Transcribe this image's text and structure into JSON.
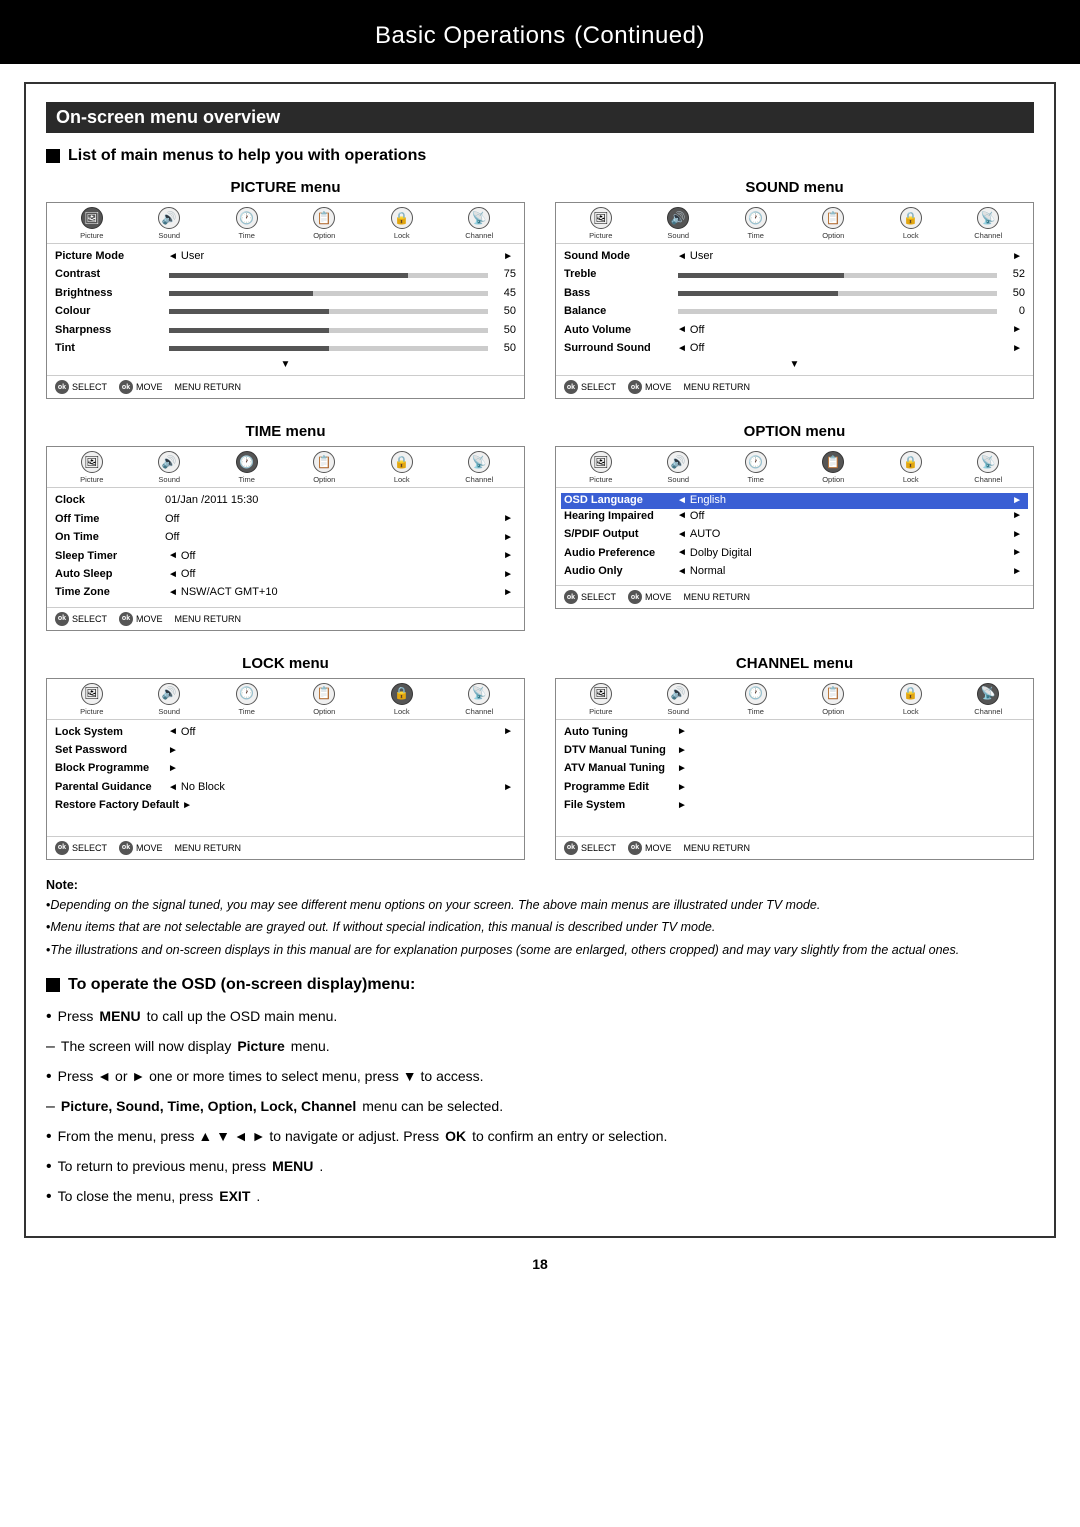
{
  "page": {
    "title": "Basic Operations",
    "title_continued": "Continued",
    "page_number": "18"
  },
  "section": {
    "header": "On-screen menu overview",
    "list_title": "List of main menus to help you with operations"
  },
  "icons": {
    "picture": "🖼",
    "sound": "🔊",
    "time": "🕐",
    "option": "📋",
    "lock": "🔒",
    "channel": "📡"
  },
  "picture_menu": {
    "title": "PICTURE menu",
    "active_icon": "Picture",
    "icons": [
      "Picture",
      "Sound",
      "Time",
      "Option",
      "Lock",
      "Channel"
    ],
    "rows": [
      {
        "label": "Picture Mode",
        "arrow_left": "◄",
        "value": "User",
        "arrow_right": "►"
      },
      {
        "label": "Contrast",
        "bar": true,
        "bar_fill": 75,
        "number": "75"
      },
      {
        "label": "Brightness",
        "bar": true,
        "bar_fill": 45,
        "number": "45"
      },
      {
        "label": "Colour",
        "bar": true,
        "bar_fill": 50,
        "number": "50"
      },
      {
        "label": "Sharpness",
        "bar": true,
        "bar_fill": 50,
        "number": "50"
      },
      {
        "label": "Tint",
        "bar": true,
        "bar_fill": 50,
        "number": "50"
      }
    ],
    "footer": [
      "SELECT",
      "MOVE",
      "RETURN"
    ]
  },
  "sound_menu": {
    "title": "SOUND menu",
    "active_icon": "Sound",
    "icons": [
      "Picture",
      "Sound",
      "Time",
      "Option",
      "Lock",
      "Channel"
    ],
    "rows": [
      {
        "label": "Sound Mode",
        "arrow_left": "◄",
        "value": "User",
        "arrow_right": "►"
      },
      {
        "label": "Treble",
        "bar": true,
        "bar_fill": 52,
        "number": "52"
      },
      {
        "label": "Bass",
        "bar": true,
        "bar_fill": 50,
        "number": "50"
      },
      {
        "label": "Balance",
        "bar": true,
        "bar_fill": 0,
        "number": "0"
      },
      {
        "label": "Auto Volume",
        "arrow_left": "◄",
        "value": "Off",
        "arrow_right": "►"
      },
      {
        "label": "Surround Sound",
        "arrow_left": "◄",
        "value": "Off",
        "arrow_right": "►"
      }
    ],
    "footer": [
      "SELECT",
      "MOVE",
      "RETURN"
    ]
  },
  "time_menu": {
    "title": "TIME menu",
    "active_icon": "Time",
    "icons": [
      "Picture",
      "Sound",
      "Time",
      "Option",
      "Lock",
      "Channel"
    ],
    "rows": [
      {
        "label": "Clock",
        "value": "01/Jan /2011 15:30",
        "clock": true
      },
      {
        "label": "Off Time",
        "value": "Off",
        "arrow_right": "►"
      },
      {
        "label": "On Time",
        "value": "Off",
        "arrow_right": "►"
      },
      {
        "label": "Sleep Timer",
        "arrow_left": "◄",
        "value": "Off",
        "arrow_right": "►"
      },
      {
        "label": "Auto Sleep",
        "arrow_left": "◄",
        "value": "Off",
        "arrow_right": "►"
      },
      {
        "label": "Time Zone",
        "arrow_left": "◄",
        "value": "NSW/ACT GMT+10",
        "arrow_right": "►"
      }
    ],
    "footer": [
      "SELECT",
      "MOVE",
      "RETURN"
    ]
  },
  "option_menu": {
    "title": "OPTION menu",
    "active_icon": "Option",
    "icons": [
      "Picture",
      "Sound",
      "Time",
      "Option",
      "Lock",
      "Channel"
    ],
    "rows": [
      {
        "label": "OSD Language",
        "arrow_left": "◄",
        "value": "English",
        "arrow_right": "►",
        "highlight": true
      },
      {
        "label": "Hearing Impaired",
        "arrow_left": "◄",
        "value": "Off",
        "arrow_right": "►"
      },
      {
        "label": "S/PDIF Output",
        "arrow_left": "◄",
        "value": "AUTO",
        "arrow_right": "►"
      },
      {
        "label": "Audio Preference",
        "arrow_left": "◄",
        "value": "Dolby Digital",
        "arrow_right": "►"
      },
      {
        "label": "Audio Only",
        "arrow_left": "◄",
        "value": "Normal",
        "arrow_right": "►"
      }
    ],
    "footer": [
      "SELECT",
      "MOVE",
      "RETURN"
    ]
  },
  "lock_menu": {
    "title": "LOCK menu",
    "active_icon": "Lock",
    "icons": [
      "Picture",
      "Sound",
      "Time",
      "Option",
      "Lock",
      "Channel"
    ],
    "rows": [
      {
        "label": "Lock System",
        "arrow_left": "◄",
        "value": "Off",
        "arrow_right": "►"
      },
      {
        "label": "Set Password",
        "arrow_right": "►"
      },
      {
        "label": "Block Programme",
        "arrow_right": "►"
      },
      {
        "label": "Parental Guidance",
        "arrow_left": "◄",
        "value": "No Block",
        "arrow_right": "►"
      },
      {
        "label": "Restore Factory Default",
        "arrow_right": "►"
      }
    ],
    "footer": [
      "SELECT",
      "MOVE",
      "RETURN"
    ]
  },
  "channel_menu": {
    "title": "CHANNEL menu",
    "active_icon": "Channel",
    "icons": [
      "Picture",
      "Sound",
      "Time",
      "Option",
      "Lock",
      "Channel"
    ],
    "rows": [
      {
        "label": "Auto Tuning",
        "arrow_right": "►"
      },
      {
        "label": "DTV Manual Tuning",
        "arrow_right": "►"
      },
      {
        "label": "ATV Manual Tuning",
        "arrow_right": "►"
      },
      {
        "label": "Programme Edit",
        "arrow_right": "►"
      },
      {
        "label": "File System",
        "arrow_right": "►"
      }
    ],
    "footer": [
      "SELECT",
      "MOVE",
      "RETURN"
    ]
  },
  "notes": {
    "label": "Note:",
    "items": [
      "Depending on the signal tuned, you may see different menu options on your screen. The above main menus are illustrated under TV mode.",
      "Menu items that are not selectable are grayed out. If without special indication, this manual is described under TV mode.",
      "The illustrations and on-screen displays in this manual are for explanation purposes (some are enlarged, others cropped) and may vary slightly from the actual ones."
    ]
  },
  "osd_section": {
    "title": "To operate the OSD (on-screen display)menu:",
    "items": [
      {
        "type": "bullet",
        "text": "Press MENU to call up the OSD main menu.",
        "bold_parts": [
          "MENU"
        ]
      },
      {
        "type": "dash",
        "text": "The screen will now display Picture menu.",
        "bold_parts": [
          "Picture"
        ]
      },
      {
        "type": "bullet",
        "text": "Press ◄ or ► one or more times to select menu, press ▼ to access."
      },
      {
        "type": "dash",
        "text": "Picture, Sound, Time, Option, Lock, Channel menu can be selected.",
        "bold_parts": [
          "Picture, Sound, Time, Option, Lock, Channel"
        ]
      },
      {
        "type": "bullet",
        "text": "From the menu, press ▲ ▼ ◄ ► to navigate or adjust. Press OK to confirm an entry or selection.",
        "bold_parts": [
          "OK"
        ]
      },
      {
        "type": "bullet",
        "text": "To return to previous menu, press MENU.",
        "bold_parts": [
          "MENU"
        ]
      },
      {
        "type": "bullet",
        "text": "To close the menu, press EXIT.",
        "bold_parts": [
          "EXIT"
        ]
      }
    ]
  }
}
